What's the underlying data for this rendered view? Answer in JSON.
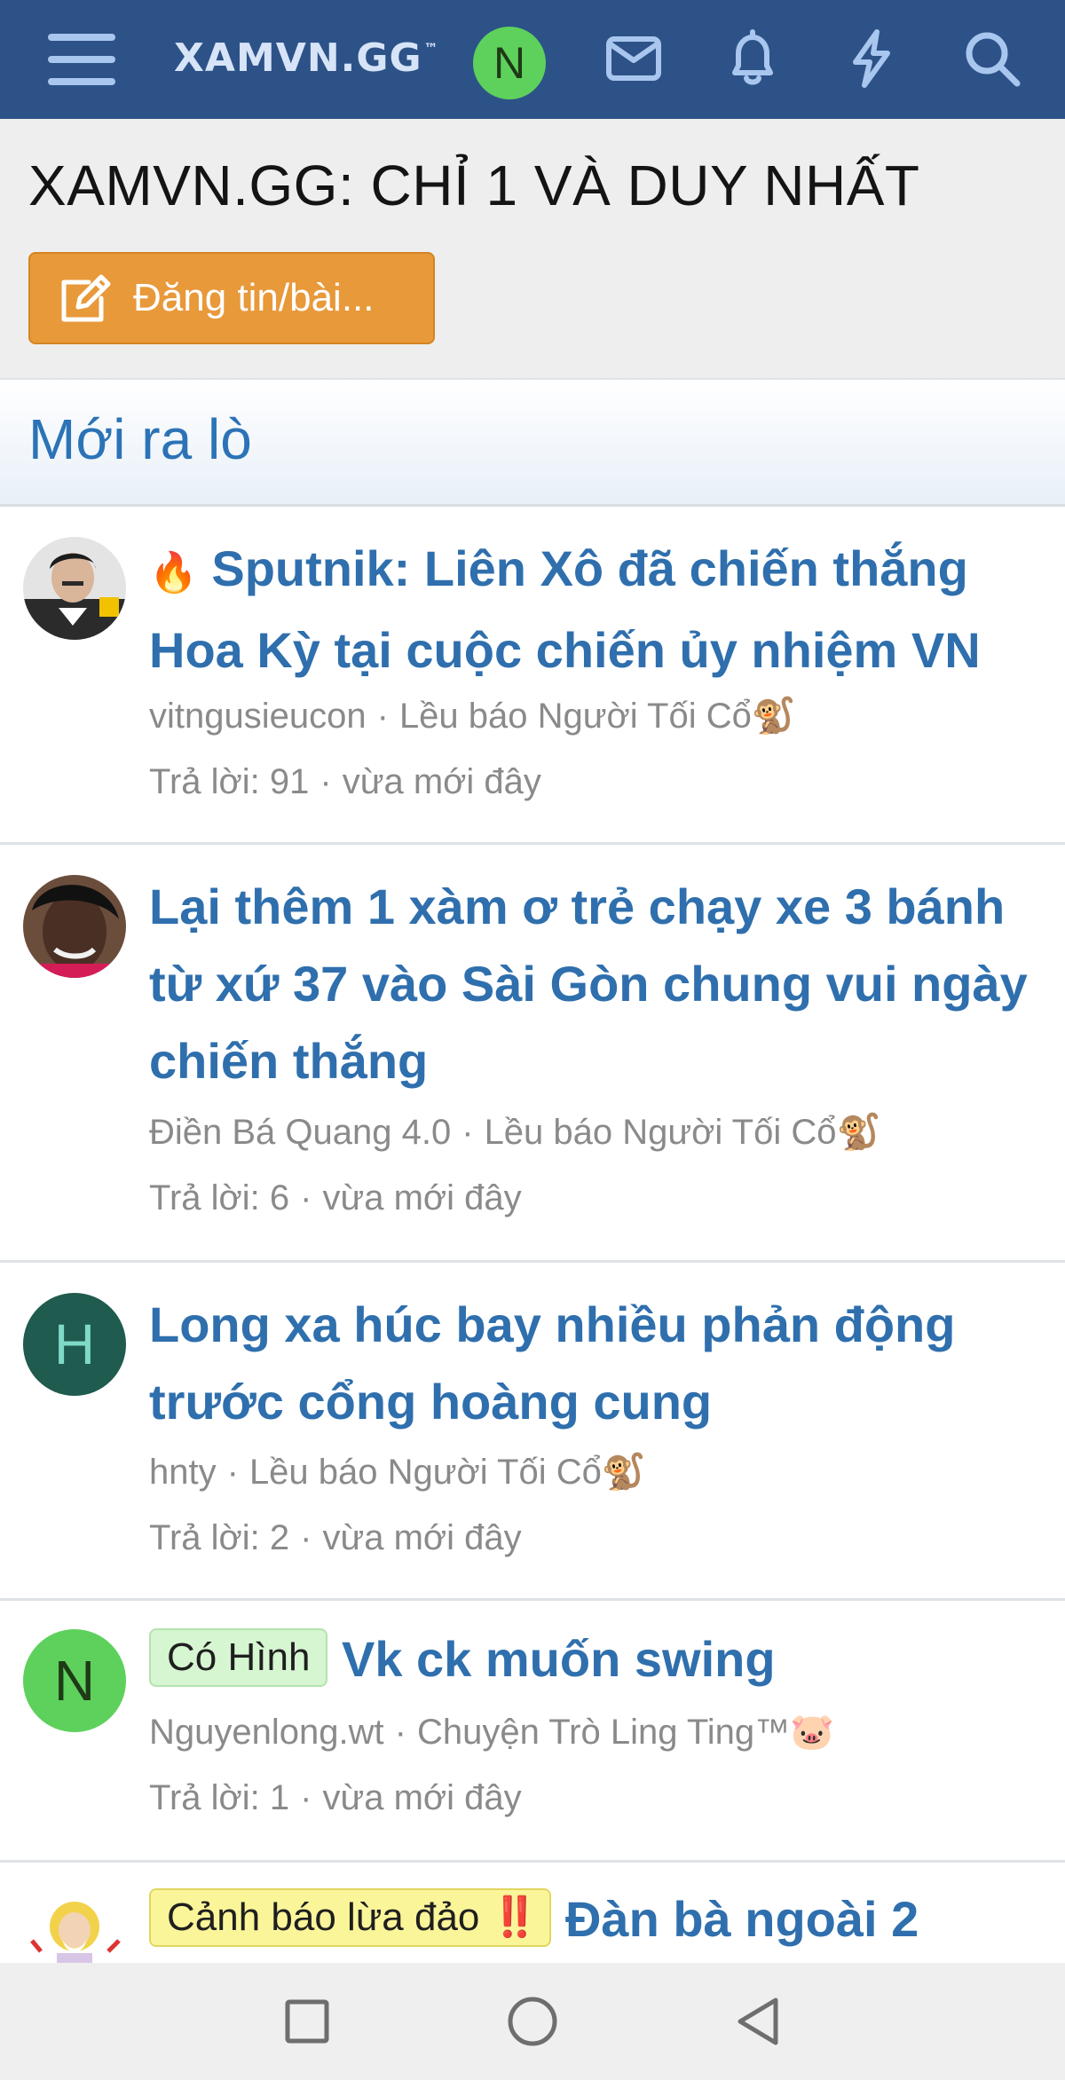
{
  "header": {
    "logo_main": "XAMVN",
    "logo_suffix": ".GG",
    "logo_tm": "™",
    "user_initial": "N",
    "icons": [
      "menu-icon",
      "mail-icon",
      "bell-icon",
      "bolt-icon",
      "search-icon"
    ],
    "colors": {
      "bar": "#2d5288",
      "avatar": "#5ed15c"
    }
  },
  "page": {
    "title": "XAMVN.GG: CHỈ 1 VÀ DUY NHẤT",
    "post_button": "Đăng tin/bài..."
  },
  "section": {
    "title": "Mới ra lò"
  },
  "threads": [
    {
      "emoji": "🔥",
      "title": "Sputnik: Liên Xô đã chiến thắng Hoa Kỳ tại cuộc chiến ủy nhiệm VN",
      "author": "vitngusieucon",
      "forum": "Lều báo Người Tối Cổ🐒",
      "replies": "Trả lời: 91",
      "time": "vừa mới đây"
    },
    {
      "title": "Lại thêm 1 xàm ơ trẻ chạy xe 3 bánh từ xứ 37 vào Sài Gòn chung vui ngày chiến thắng",
      "author": "Điền Bá Quang 4.0",
      "forum": "Lều báo Người Tối Cổ🐒",
      "replies": "Trả lời: 6",
      "time": "vừa mới đây"
    },
    {
      "avatar_initial": "H",
      "title": "Long xa húc bay nhiều phản động trước cổng hoàng cung",
      "author": "hnty",
      "forum": "Lều báo Người Tối Cổ🐒",
      "replies": "Trả lời: 2",
      "time": "vừa mới đây"
    },
    {
      "avatar_initial": "N",
      "prefix": "Có Hình",
      "title": "Vk ck muốn swing",
      "author": "Nguyenlong.wt",
      "forum": "Chuyện Trò Ling Ting™🐷",
      "replies": "Trả lời: 1",
      "time": "vừa mới đây"
    },
    {
      "prefix": "Cảnh báo lừa đảo",
      "prefix_mark": "‼️",
      "title": "Đàn bà ngoài 2"
    }
  ],
  "navbar": {
    "icons": [
      "square-icon",
      "circle-icon",
      "triangle-back-icon"
    ]
  }
}
